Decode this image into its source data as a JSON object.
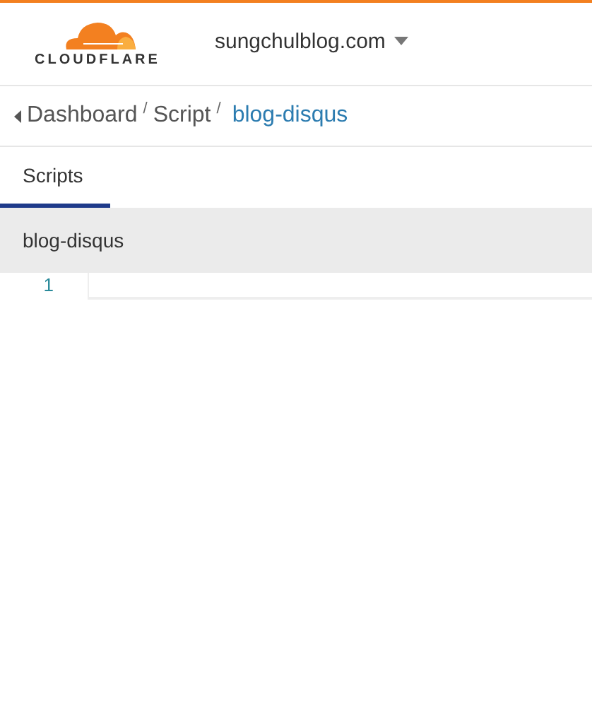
{
  "header": {
    "logo_text": "CLOUDFLARE",
    "domain": "sungchulblog.com"
  },
  "breadcrumb": [
    {
      "label": "Dashboard",
      "current": false
    },
    {
      "label": "/",
      "kind": "separator"
    },
    {
      "label": "Script",
      "current": false
    },
    {
      "label": "/",
      "kind": "separator"
    },
    {
      "label": "blog-disqus",
      "current": true
    }
  ],
  "tabs": [
    {
      "label": "Scripts",
      "selected": true
    }
  ],
  "file": {
    "name": "blog-disqus"
  },
  "editor": {
    "line_numbers": [
      "1"
    ]
  }
}
